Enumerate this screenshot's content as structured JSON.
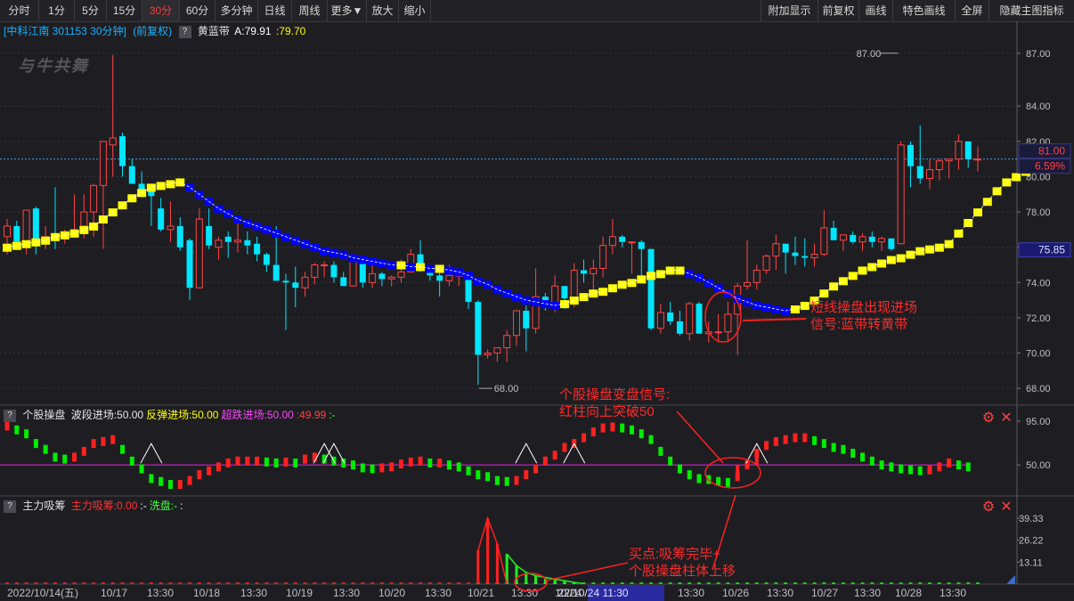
{
  "toolbar": {
    "left": [
      "分时",
      "1分",
      "5分",
      "15分",
      "30分",
      "60分",
      "多分钟",
      "日线",
      "周线",
      "更多▼",
      "放大",
      "缩小"
    ],
    "active": "30分",
    "right": [
      "附加显示",
      "前复权",
      "画线",
      "特色画线",
      "全屏",
      "隐藏主图指标"
    ]
  },
  "main_header": {
    "stock": "[中科江南 301153 30分钟]",
    "adjust": "(前复权)",
    "indicator": "黄蓝带",
    "value_label": "A:79.91",
    "value2": ":79.70"
  },
  "watermark": "与牛共舞",
  "osc_header": {
    "name": "个股操盘",
    "items": [
      {
        "text": "波段进场:50.00",
        "color": "#e8e8e8"
      },
      {
        "text": "反弹进场:50.00",
        "color": "#ffff00"
      },
      {
        "text": "超跌进场:50.00",
        "color": "#ff44ff"
      },
      {
        "text": ":49.99",
        "color": "#ff4444"
      },
      {
        "text": ":-",
        "color": "#44ff44"
      }
    ]
  },
  "vol_header": {
    "name": "主力吸筹",
    "items": [
      {
        "text": "主力吸筹:0.00",
        "color": "#ff3333"
      },
      {
        "text": ":-",
        "color": "#ffffff"
      },
      {
        "text": "洗盘:-",
        "color": "#44ff44"
      },
      {
        "text": ":",
        "color": "#ffffff"
      }
    ]
  },
  "annotations": {
    "short_signal": [
      "短线操盘出现进场",
      "信号:蓝带转黄带"
    ],
    "change_signal": [
      "个股操盘变盘信号:",
      "红柱向上突破50"
    ],
    "buy_point": [
      "买点:吸筹完毕+",
      "个股操盘柱体上移"
    ]
  },
  "price_tags": {
    "current": "81.00",
    "change": "6.59%",
    "yellow": "75.85",
    "high": "87.00",
    "low": "68.00"
  },
  "colors": {
    "up": "#ff4545",
    "down": "#00e5ff",
    "band_up": "#ffff00",
    "band_down": "#0000ff",
    "osc_up": "#ff2020",
    "osc_down": "#00ee00",
    "purple": "#d020d0"
  },
  "chart_data": [
    {
      "type": "candlestick",
      "title": "中科江南 301153 30分钟",
      "ylim": [
        67.2,
        88.0
      ],
      "y_ticks": [
        "87.00",
        "84.00",
        "82.00",
        "80.00",
        "78.00",
        "76.00",
        "74.00",
        "72.00",
        "70.00",
        "68.00"
      ],
      "x_labels": [
        "2022/10/14(五)",
        "10/17",
        "13:30",
        "10/18",
        "13:30",
        "10/19",
        "13:30",
        "10/20",
        "13:30",
        "10/21",
        "13:30",
        "10/24",
        "22/10/24 11:30",
        "13:30",
        "10/26",
        "13:30",
        "10/27",
        "13:30",
        "10/28",
        "13:30"
      ],
      "ohlc": [
        [
          76.6,
          77.6,
          75.6,
          77.2
        ],
        [
          77.2,
          77.5,
          76.4,
          76.3
        ],
        [
          76.1,
          78.1,
          75.6,
          78.1
        ],
        [
          78.2,
          78.3,
          75.6,
          76.2
        ],
        [
          76.4,
          77.2,
          75.9,
          76.6
        ],
        [
          76.6,
          79.4,
          75.9,
          76.5
        ],
        [
          76.5,
          77.0,
          76.2,
          76.8
        ],
        [
          76.8,
          79.0,
          76.6,
          77.0
        ],
        [
          77.2,
          79.0,
          76.5,
          78.0
        ],
        [
          78.0,
          79.6,
          76.6,
          79.5
        ],
        [
          79.5,
          82.0,
          75.9,
          82.0
        ],
        [
          81.8,
          86.9,
          80.0,
          82.2
        ],
        [
          82.3,
          82.5,
          80.0,
          80.6
        ],
        [
          80.6,
          81.0,
          79.6,
          79.6
        ],
        [
          79.6,
          80.3,
          78.9,
          79.0
        ],
        [
          79.2,
          79.4,
          77.2,
          78.9
        ],
        [
          78.2,
          78.8,
          76.9,
          77.0
        ],
        [
          77.0,
          78.6,
          76.3,
          77.2
        ],
        [
          77.2,
          77.7,
          75.8,
          76.0
        ],
        [
          76.4,
          76.5,
          73.0,
          73.7
        ],
        [
          73.7,
          78.2,
          73.7,
          77.6
        ],
        [
          77.2,
          78.2,
          75.9,
          76.1
        ],
        [
          76.0,
          76.6,
          75.3,
          76.4
        ],
        [
          76.6,
          76.9,
          75.4,
          76.3
        ],
        [
          76.3,
          77.4,
          75.7,
          76.4
        ],
        [
          76.4,
          76.9,
          75.6,
          76.1
        ],
        [
          76.2,
          76.6,
          75.2,
          75.6
        ],
        [
          75.6,
          75.7,
          74.6,
          75.0
        ],
        [
          75.0,
          77.2,
          74.4,
          74.1
        ],
        [
          74.1,
          74.5,
          71.3,
          74.0
        ],
        [
          74.0,
          74.9,
          72.6,
          73.7
        ],
        [
          73.7,
          74.6,
          73.2,
          74.3
        ],
        [
          74.3,
          75.1,
          73.9,
          75.0
        ],
        [
          75.0,
          75.2,
          74.3,
          75.0
        ],
        [
          75.0,
          75.2,
          74.0,
          74.3
        ],
        [
          74.3,
          74.6,
          73.8,
          73.8
        ],
        [
          73.8,
          75.3,
          73.8,
          75.2
        ],
        [
          75.1,
          75.1,
          73.7,
          74.0
        ],
        [
          74.0,
          75.0,
          73.7,
          74.5
        ],
        [
          74.5,
          74.6,
          73.8,
          74.2
        ],
        [
          74.2,
          74.4,
          73.8,
          74.3
        ],
        [
          74.3,
          75.3,
          74.0,
          74.6
        ],
        [
          74.6,
          75.9,
          74.6,
          75.6
        ],
        [
          75.6,
          76.4,
          74.6,
          74.7
        ],
        [
          74.7,
          74.8,
          74.1,
          74.4
        ],
        [
          74.4,
          74.7,
          73.2,
          74.1
        ],
        [
          74.1,
          75.0,
          73.8,
          74.4
        ],
        [
          74.4,
          74.8,
          73.8,
          74.4
        ],
        [
          74.4,
          74.6,
          72.5,
          72.9
        ],
        [
          72.9,
          73.0,
          68.2,
          69.9
        ],
        [
          69.9,
          70.2,
          69.7,
          70.0
        ],
        [
          70.0,
          70.3,
          69.5,
          70.3
        ],
        [
          70.3,
          71.3,
          69.5,
          71.0
        ],
        [
          71.0,
          72.4,
          70.4,
          72.4
        ],
        [
          72.4,
          72.7,
          70.1,
          71.4
        ],
        [
          71.4,
          74.8,
          71.1,
          73.2
        ],
        [
          73.2,
          73.4,
          72.4,
          72.8
        ],
        [
          72.8,
          74.4,
          72.3,
          73.8
        ],
        [
          73.8,
          73.8,
          72.5,
          73.1
        ],
        [
          73.1,
          75.1,
          72.6,
          74.7
        ],
        [
          74.7,
          75.3,
          74.0,
          74.5
        ],
        [
          74.5,
          75.3,
          73.6,
          74.8
        ],
        [
          74.8,
          76.6,
          74.3,
          76.1
        ],
        [
          76.1,
          77.6,
          75.6,
          76.6
        ],
        [
          76.6,
          76.7,
          76.0,
          76.3
        ],
        [
          76.3,
          76.3,
          74.5,
          76.3
        ],
        [
          76.3,
          76.4,
          74.4,
          75.9
        ],
        [
          75.9,
          75.9,
          71.3,
          71.4
        ],
        [
          71.4,
          72.8,
          71.1,
          72.3
        ],
        [
          72.3,
          72.9,
          71.6,
          71.8
        ],
        [
          71.8,
          72.4,
          71.0,
          71.1
        ],
        [
          71.1,
          72.9,
          70.7,
          72.8
        ],
        [
          72.8,
          72.9,
          71.5,
          71.1
        ],
        [
          71.1,
          71.8,
          70.6,
          71.2
        ],
        [
          71.2,
          72.2,
          70.6,
          71.2
        ],
        [
          71.2,
          72.9,
          70.6,
          72.2
        ],
        [
          72.2,
          74.0,
          69.9,
          73.8
        ],
        [
          73.8,
          76.4,
          73.6,
          74.0
        ],
        [
          74.0,
          75.0,
          73.6,
          74.7
        ],
        [
          74.7,
          75.6,
          74.5,
          75.5
        ],
        [
          75.5,
          76.7,
          74.7,
          76.2
        ],
        [
          76.2,
          76.2,
          74.5,
          75.7
        ],
        [
          75.7,
          76.6,
          75.0,
          75.5
        ],
        [
          75.5,
          76.5,
          74.9,
          75.4
        ],
        [
          75.4,
          76.2,
          74.9,
          75.6
        ],
        [
          75.6,
          78.1,
          75.5,
          77.1
        ],
        [
          77.1,
          77.5,
          76.4,
          76.4
        ],
        [
          76.4,
          76.7,
          75.8,
          76.7
        ],
        [
          76.7,
          76.9,
          76.2,
          76.3
        ],
        [
          76.3,
          76.8,
          75.8,
          76.6
        ],
        [
          76.6,
          76.9,
          76.0,
          76.3
        ],
        [
          76.3,
          76.6,
          75.8,
          76.5
        ],
        [
          76.5,
          76.5,
          75.8,
          75.9
        ],
        [
          76.2,
          82.0,
          76.2,
          81.8
        ],
        [
          81.8,
          82.0,
          79.4,
          80.6
        ],
        [
          80.6,
          82.9,
          79.6,
          79.9
        ],
        [
          79.9,
          81.0,
          79.3,
          80.4
        ],
        [
          80.4,
          81.0,
          79.8,
          80.9
        ],
        [
          80.9,
          81.0,
          79.9,
          81.0
        ],
        [
          81.0,
          82.4,
          80.4,
          82.0
        ],
        [
          82.0,
          82.0,
          80.5,
          81.0
        ],
        [
          81.0,
          81.7,
          80.3,
          81.0
        ]
      ],
      "band": [
        76.0,
        76.1,
        76.2,
        76.3,
        76.4,
        76.6,
        76.7,
        76.8,
        77.0,
        77.2,
        77.6,
        78.0,
        78.4,
        78.8,
        79.1,
        79.4,
        79.5,
        79.6,
        79.7,
        79.4,
        79.0,
        78.6,
        78.2,
        77.9,
        77.6,
        77.4,
        77.2,
        77.0,
        76.8,
        76.6,
        76.4,
        76.2,
        76.0,
        75.8,
        75.7,
        75.6,
        75.4,
        75.3,
        75.2,
        75.1,
        75.0,
        75.0,
        74.9,
        74.9,
        74.8,
        74.8,
        74.7,
        74.6,
        74.4,
        74.1,
        73.9,
        73.6,
        73.4,
        73.2,
        73.0,
        72.9,
        72.8,
        72.7,
        72.8,
        73.0,
        73.2,
        73.4,
        73.5,
        73.7,
        73.9,
        74.0,
        74.2,
        74.4,
        74.5,
        74.7,
        74.7,
        74.5,
        74.3,
        74.0,
        73.7,
        73.4,
        73.1,
        72.9,
        72.7,
        72.6,
        72.5,
        72.4,
        72.5,
        72.7,
        73.0,
        73.4,
        73.8,
        74.1,
        74.4,
        74.7,
        74.9,
        75.1,
        75.3,
        75.4,
        75.6,
        75.8,
        75.9,
        76.0,
        76.2,
        76.8,
        77.4,
        78.0,
        78.6,
        79.2,
        79.7,
        80.0,
        80.3
      ]
    },
    {
      "type": "oscillator",
      "title": "个股操盘",
      "ylim": [
        20,
        95
      ],
      "y_ticks": [
        "95.00",
        "50.00"
      ],
      "values": [
        90,
        86,
        82,
        72,
        66,
        58,
        56,
        58,
        64,
        72,
        74,
        76,
        66,
        54,
        46,
        36,
        33,
        30,
        30,
        34,
        40,
        44,
        48,
        52,
        54,
        54,
        54,
        53,
        52,
        53,
        52,
        56,
        58,
        56,
        54,
        52,
        50,
        47,
        46,
        47,
        48,
        51,
        53,
        54,
        52,
        52,
        50,
        48,
        44,
        40,
        38,
        34,
        33,
        34,
        40,
        46,
        54,
        60,
        68,
        72,
        78,
        84,
        88,
        89,
        88,
        86,
        82,
        76,
        64,
        54,
        46,
        40,
        36,
        35,
        33,
        32,
        38,
        50,
        62,
        70,
        74,
        76,
        78,
        78,
        75,
        72,
        68,
        66,
        62,
        58,
        54,
        50,
        48,
        46,
        45,
        44,
        45,
        48,
        52,
        50,
        48
      ],
      "reference": 50,
      "triangles_at": [
        15,
        33,
        34,
        54,
        59,
        78
      ]
    },
    {
      "type": "bar",
      "title": "主力吸筹",
      "ylim": [
        0,
        43
      ],
      "y_ticks": [
        "39.33",
        "26.22",
        "13.11"
      ],
      "series": [
        {
          "color": "#ff2020",
          "values_at": {
            "49": 20,
            "50": 39.3,
            "51": 24
          }
        },
        {
          "color": "#22ee22",
          "values_at": {
            "52": 18,
            "53": 11,
            "54": 7,
            "55": 5,
            "56": 4,
            "57": 3,
            "58": 2,
            "59": 1
          }
        }
      ]
    }
  ]
}
